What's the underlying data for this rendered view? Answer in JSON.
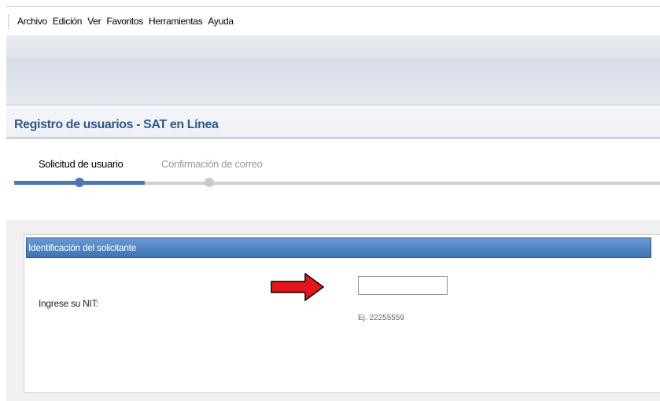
{
  "menu": {
    "items": [
      "Archivo",
      "Edición",
      "Ver",
      "Favoritos",
      "Herramientas",
      "Ayuda"
    ]
  },
  "page": {
    "title": "Registro de usuarios - SAT en Línea"
  },
  "wizard": {
    "steps": [
      {
        "label": "Solicitud de usuario",
        "state": "active"
      },
      {
        "label": "Confirmación de correo",
        "state": "inactive"
      }
    ]
  },
  "form": {
    "section_title": "Identificación del solicitante",
    "nit_label": "Ingrese su NIT:",
    "nit_value": "",
    "nit_hint": "Ej. 22255559"
  },
  "colors": {
    "accent": "#4a78b7",
    "title": "#2f5a8c",
    "arrow": "#e8141a"
  }
}
